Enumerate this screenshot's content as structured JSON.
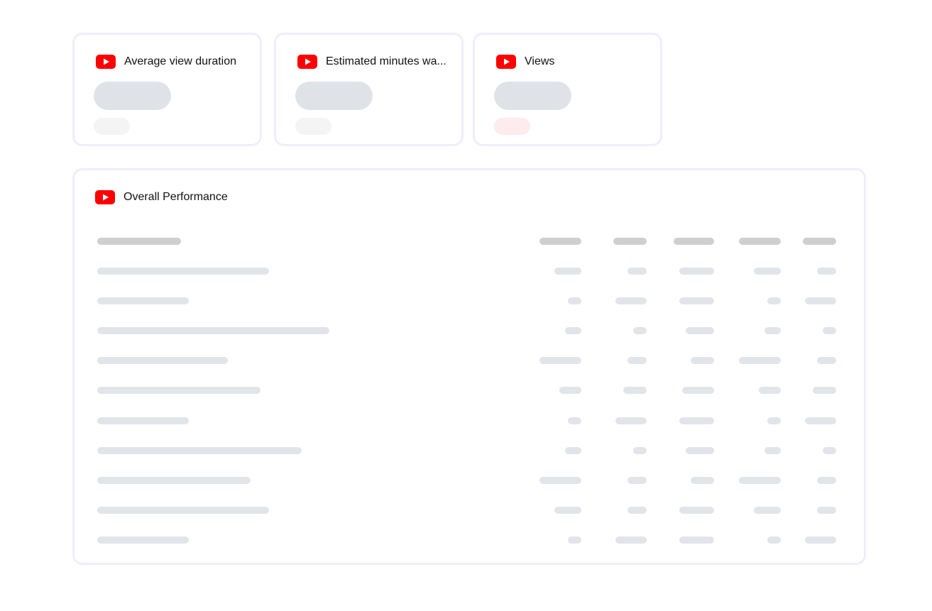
{
  "metric_cards": [
    {
      "title": "Average view duration",
      "icon": "youtube-icon",
      "delta_state": "neutral"
    },
    {
      "title": "Estimated minutes wa...",
      "icon": "youtube-icon",
      "delta_state": "neutral"
    },
    {
      "title": "Views",
      "icon": "youtube-icon",
      "delta_state": "positive"
    }
  ],
  "performance": {
    "title": "Overall Performance",
    "icon": "youtube-icon",
    "column_count": 6,
    "row_count": 10
  },
  "colors": {
    "youtube_red": "#ff0000",
    "card_border": "#eeeefb",
    "skeleton": "#e1e5e9",
    "skeleton_header": "#cfcfcf",
    "skeleton_value": "#dfe3e8",
    "skeleton_delta": "#f3f4f5",
    "skeleton_delta_positive": "#fdebee"
  }
}
